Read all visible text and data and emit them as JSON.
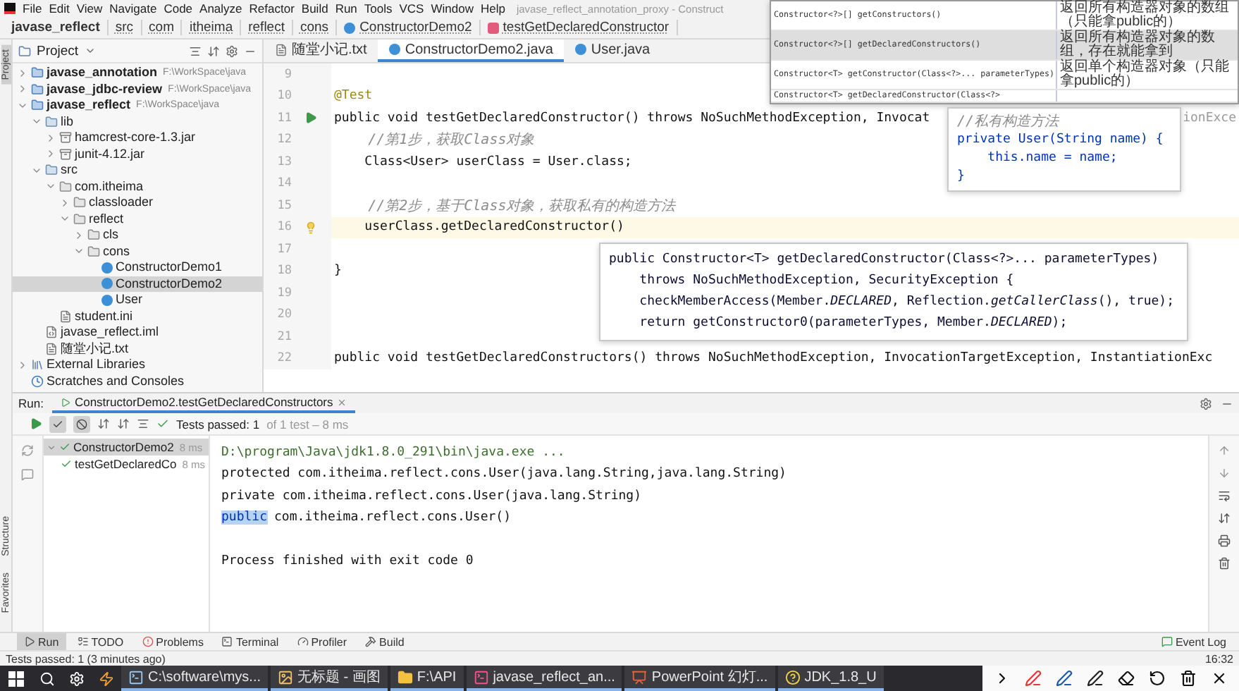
{
  "menu": [
    "File",
    "Edit",
    "View",
    "Navigate",
    "Code",
    "Analyze",
    "Refactor",
    "Build",
    "Run",
    "Tools",
    "VCS",
    "Window",
    "Help"
  ],
  "window_title": "javase_reflect_annotation_proxy - Construct",
  "breadcrumb": [
    {
      "label": "javase_reflect",
      "kind": "module"
    },
    {
      "label": "src",
      "kind": "folder"
    },
    {
      "label": "com",
      "kind": "folder"
    },
    {
      "label": "itheima",
      "kind": "folder"
    },
    {
      "label": "reflect",
      "kind": "folder"
    },
    {
      "label": "cons",
      "kind": "folder"
    },
    {
      "label": "ConstructorDemo2",
      "kind": "class"
    },
    {
      "label": "testGetDeclaredConstructor",
      "kind": "method"
    }
  ],
  "side_strip": {
    "top": [
      {
        "label": "Project",
        "selected": true
      }
    ],
    "bottom": [
      {
        "label": "Structure",
        "selected": false
      },
      {
        "label": "Favorites",
        "selected": false
      }
    ]
  },
  "project_panel": {
    "title": "Project",
    "tree": [
      {
        "label": "javase_annotation",
        "path": "F:\\WorkSpace\\java",
        "kind": "module",
        "expanded": false,
        "selected": false
      },
      {
        "label": "javase_jdbc-review",
        "path": "F:\\WorkSpace\\java",
        "kind": "module",
        "expanded": false,
        "selected": false
      },
      {
        "label": "javase_reflect",
        "path": "F:\\WorkSpace\\java",
        "kind": "module",
        "expanded": true,
        "selected": false,
        "children": [
          {
            "label": "lib",
            "kind": "folder",
            "expanded": true,
            "selected": false,
            "children": [
              {
                "label": "hamcrest-core-1.3.jar",
                "kind": "jar",
                "expanded": false,
                "selected": false
              },
              {
                "label": "junit-4.12.jar",
                "kind": "jar",
                "expanded": false,
                "selected": false
              }
            ]
          },
          {
            "label": "src",
            "kind": "folder",
            "expanded": true,
            "selected": false,
            "children": [
              {
                "label": "com.itheima",
                "kind": "package",
                "expanded": true,
                "selected": false,
                "children": [
                  {
                    "label": "classloader",
                    "kind": "package",
                    "expanded": false,
                    "selected": false
                  },
                  {
                    "label": "reflect",
                    "kind": "package",
                    "expanded": true,
                    "selected": false,
                    "children": [
                      {
                        "label": "cls",
                        "kind": "package",
                        "expanded": false,
                        "selected": false
                      },
                      {
                        "label": "cons",
                        "kind": "package",
                        "expanded": true,
                        "selected": false,
                        "children": [
                          {
                            "label": "ConstructorDemo1",
                            "kind": "class",
                            "selected": false
                          },
                          {
                            "label": "ConstructorDemo2",
                            "kind": "class",
                            "selected": true
                          },
                          {
                            "label": "User",
                            "kind": "class",
                            "selected": false
                          }
                        ]
                      }
                    ]
                  }
                ]
              },
              {
                "label": "student.ini",
                "kind": "file",
                "selected": false
              }
            ]
          },
          {
            "label": "javase_reflect.iml",
            "kind": "config",
            "selected": false
          },
          {
            "label": "随堂小记.txt",
            "kind": "file",
            "selected": false
          }
        ]
      },
      {
        "label": "External Libraries",
        "kind": "libraries",
        "expanded": false,
        "selected": false
      },
      {
        "label": "Scratches and Consoles",
        "kind": "scratches",
        "selected": false
      }
    ]
  },
  "editor": {
    "tabs": [
      {
        "label": "随堂小记.txt",
        "kind": "text",
        "selected": false
      },
      {
        "label": "ConstructorDemo2.java",
        "kind": "class",
        "selected": true
      },
      {
        "label": "User.java",
        "kind": "class",
        "selected": false
      }
    ],
    "lines": [
      {
        "number": "9",
        "kind": "blank",
        "current": false
      },
      {
        "number": "10",
        "kind": "annotation",
        "text": "@Test",
        "current": false
      },
      {
        "number": "11",
        "kind": "code",
        "text": "public void testGetDeclaredConstructor() throws NoSuchMethodException, Invocat",
        "tail": "ionExce",
        "run_icon": true,
        "current": false
      },
      {
        "number": "12",
        "kind": "comment",
        "text": "    //第1步，获取Class对象",
        "current": false
      },
      {
        "number": "13",
        "kind": "code",
        "text": "    Class<User> userClass = User.class;",
        "current": false
      },
      {
        "number": "14",
        "kind": "blank",
        "current": false
      },
      {
        "number": "15",
        "kind": "comment",
        "text": "    //第2步，基于Class对象，获取私有的构造方法",
        "current": false
      },
      {
        "number": "16",
        "kind": "code",
        "text": "    userClass.getDeclaredConstructor()",
        "intention_bulb": true,
        "current": true
      },
      {
        "number": "17",
        "kind": "blank",
        "current": false
      },
      {
        "number": "18",
        "kind": "code",
        "text": "}",
        "current": false
      },
      {
        "number": "19",
        "kind": "blank",
        "current": false
      },
      {
        "number": "20",
        "kind": "blank",
        "current": false
      },
      {
        "number": "21",
        "kind": "blank",
        "current": false
      },
      {
        "number": "22",
        "kind": "code",
        "text": "public void testGetDeclaredConstructors() throws NoSuchMethodException, InvocationTargetException, InstantiationExc",
        "current": false
      }
    ]
  },
  "method_table": [
    {
      "signature": "Constructor<?>[] getConstructors()",
      "description": "返回所有构造器对象的数组（只能拿public的）",
      "selected": false
    },
    {
      "signature": "Constructor<?>[] getDeclaredConstructors()",
      "description": "返回所有构造器对象的数组，存在就能拿到",
      "selected": true
    },
    {
      "signature": "Constructor<T> getConstructor(Class<?>... parameterTypes)",
      "description": "返回单个构造器对象（只能拿public的）",
      "selected": false
    },
    {
      "signature": "Constructor<T> getDeclaredConstructor(Class<?>",
      "selected": false
    }
  ],
  "source_tooltip": [
    {
      "kind": "comment",
      "text": "//私有构造方法"
    },
    {
      "kind": "code",
      "text": "private User(String name) {"
    },
    {
      "kind": "code",
      "text": "    this.name = name;"
    },
    {
      "kind": "code",
      "text": "}"
    }
  ],
  "quick_doc": [
    "public Constructor<T> getDeclaredConstructor(Class<?>... parameterTypes)",
    "    throws NoSuchMethodException, SecurityException {",
    "    checkMemberAccess(Member.*DECLARED*, Reflection.*getCallerClass*(), true);",
    "    return getConstructor0(parameterTypes, Member.*DECLARED*);"
  ],
  "run_panel": {
    "label": "Run:",
    "tab": "ConstructorDemo2.testGetDeclaredConstructors",
    "toggles": [
      {
        "kind": "passed",
        "selected": true
      },
      {
        "kind": "ignored",
        "selected": true
      }
    ],
    "status": "Tests passed: 1",
    "status_detail": "of 1 test – 8 ms",
    "tests": [
      {
        "name": "ConstructorDemo2",
        "time": "8 ms",
        "expanded": true,
        "selected": true,
        "children": [
          {
            "name": "testGetDeclaredCo",
            "time": "8 ms",
            "selected": false
          }
        ]
      }
    ],
    "console": [
      {
        "kind": "command",
        "text": "D:\\program\\Java\\jdk1.8.0_291\\bin\\java.exe ..."
      },
      {
        "kind": "output",
        "text": "protected com.itheima.reflect.cons.User(java.lang.String,java.lang.String)"
      },
      {
        "kind": "output",
        "text": "private com.itheima.reflect.cons.User(java.lang.String)"
      },
      {
        "kind": "output",
        "highlighted": "public",
        "text": "com.itheima.reflect.cons.User()"
      },
      {
        "kind": "blank"
      },
      {
        "kind": "output",
        "text": "Process finished with exit code 0"
      }
    ]
  },
  "tool_tabs": [
    {
      "label": "Run",
      "kind": "run",
      "selected": true
    },
    {
      "label": "TODO",
      "kind": "todo",
      "selected": false
    },
    {
      "label": "Problems",
      "kind": "problems",
      "selected": false
    },
    {
      "label": "Terminal",
      "kind": "terminal",
      "selected": false
    },
    {
      "label": "Profiler",
      "kind": "profiler",
      "selected": false
    },
    {
      "label": "Build",
      "kind": "build",
      "selected": false
    }
  ],
  "event_log": "Event Log",
  "status_bar": {
    "text": "Tests passed: 1 (3 minutes ago)",
    "time": "16:32"
  },
  "taskbar": {
    "items": [
      {
        "label": "C:\\software\\mys...",
        "kind": "terminal"
      },
      {
        "label": "无标题 - 画图",
        "kind": "paint"
      },
      {
        "label": "F:\\API",
        "kind": "folder"
      },
      {
        "label": "javase_reflect_an...",
        "kind": "ide"
      },
      {
        "label": "PowerPoint 幻灯...",
        "kind": "slides"
      },
      {
        "label": "JDK_1.8_U",
        "kind": "help"
      }
    ],
    "pen_tools": [
      {
        "kind": "expand"
      },
      {
        "kind": "pen",
        "color": "#e53935"
      },
      {
        "kind": "pen",
        "color": "#1e5aa8"
      },
      {
        "kind": "pen",
        "color": "#222222"
      },
      {
        "kind": "eraser"
      },
      {
        "kind": "undo"
      },
      {
        "kind": "trash"
      },
      {
        "kind": "close"
      }
    ]
  }
}
